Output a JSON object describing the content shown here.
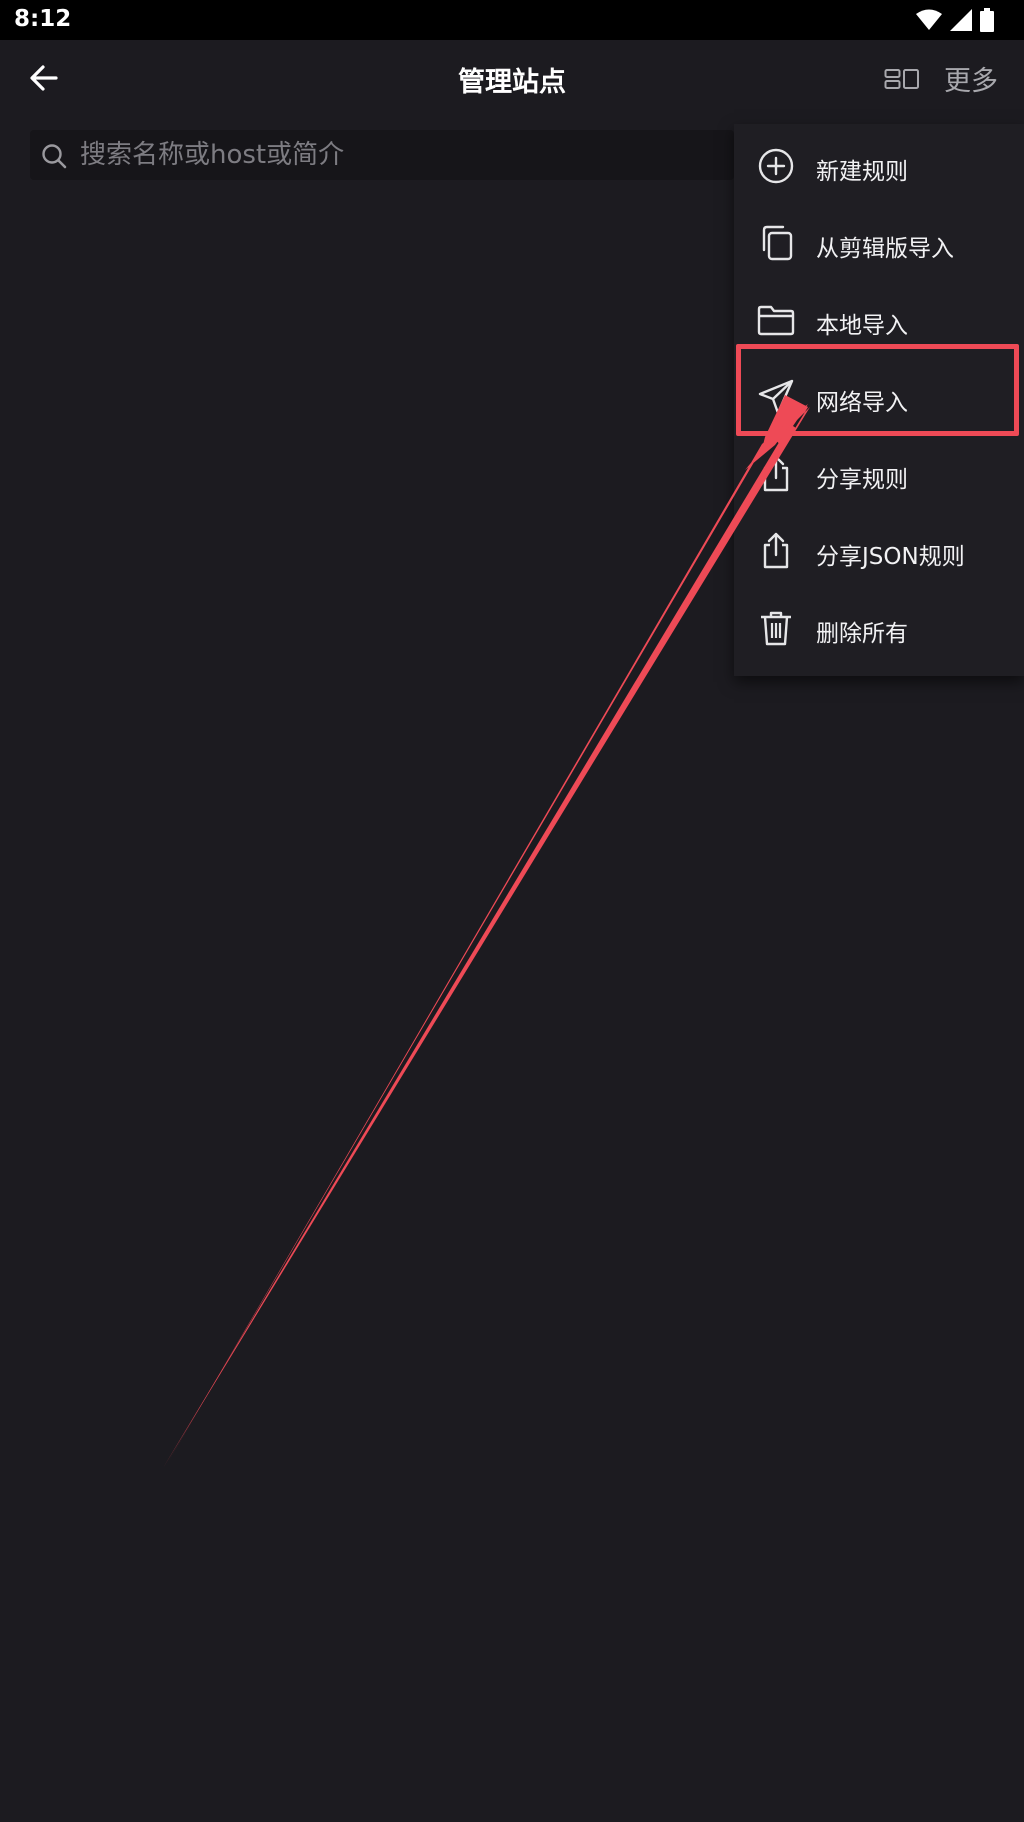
{
  "status_bar": {
    "time": "8:12"
  },
  "header": {
    "title": "管理站点",
    "more_label": "更多"
  },
  "search": {
    "placeholder": "搜索名称或host或简介"
  },
  "menu": {
    "items": [
      {
        "label": "新建规则",
        "icon": "add-circle-icon"
      },
      {
        "label": "从剪辑版导入",
        "icon": "copy-icon"
      },
      {
        "label": "本地导入",
        "icon": "folder-icon"
      },
      {
        "label": "网络导入",
        "icon": "send-icon"
      },
      {
        "label": "分享规则",
        "icon": "share-icon"
      },
      {
        "label": "分享JSON规则",
        "icon": "share-icon"
      },
      {
        "label": "删除所有",
        "icon": "trash-icon"
      }
    ],
    "highlighted_item": "网络导入"
  },
  "colors": {
    "background": "#1c1b20",
    "menu_background": "#1f1e23",
    "annotation": "#ee4a56"
  }
}
